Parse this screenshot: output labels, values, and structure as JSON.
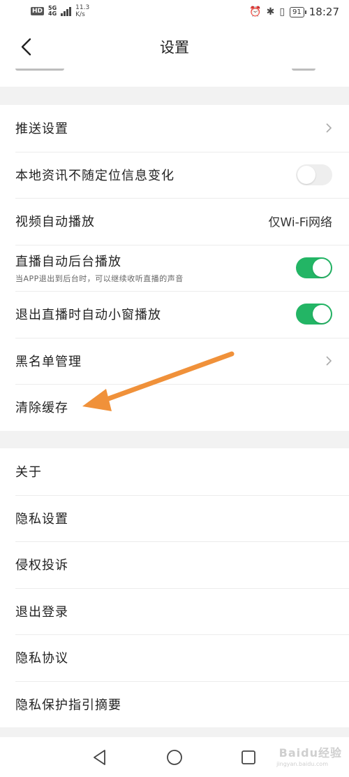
{
  "status_bar": {
    "hd": "HD",
    "network": "5G",
    "network_sub": "4G",
    "speed_value": "11.3",
    "speed_unit": "K/s",
    "battery": "91",
    "time": "18:27"
  },
  "navbar": {
    "title": "设置"
  },
  "group1": [
    {
      "label": "推送设置",
      "type": "chevron"
    },
    {
      "label": "本地资讯不随定位信息变化",
      "type": "toggle",
      "on": false
    },
    {
      "label": "视频自动播放",
      "type": "value",
      "value": "仅Wi-Fi网络"
    },
    {
      "label": "直播自动后台播放",
      "sub": "当APP退出到后台时，可以继续收听直播的声音",
      "type": "toggle",
      "on": true
    },
    {
      "label": "退出直播时自动小窗播放",
      "type": "toggle",
      "on": true
    },
    {
      "label": "黑名单管理",
      "type": "chevron"
    },
    {
      "label": "清除缓存",
      "type": "none"
    }
  ],
  "group2": [
    {
      "label": "关于"
    },
    {
      "label": "隐私设置"
    },
    {
      "label": "侵权投诉"
    },
    {
      "label": "退出登录"
    },
    {
      "label": "隐私协议"
    },
    {
      "label": "隐私保护指引摘要"
    }
  ],
  "colors": {
    "toggle_on": "#23b565",
    "toggle_off": "#eeeeee",
    "annotation_arrow": "#f0913a"
  },
  "watermark": {
    "text": "Baidu经验",
    "sub": "jingyan.baidu.com"
  }
}
